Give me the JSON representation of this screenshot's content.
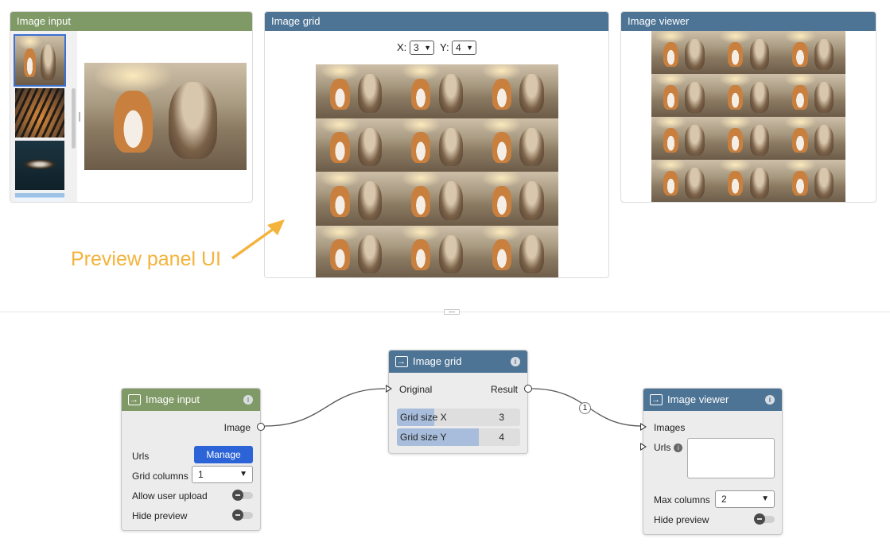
{
  "preview": {
    "image_input": {
      "title": "Image input"
    },
    "image_grid": {
      "title": "Image grid",
      "x_label": "X:",
      "x_value": "3",
      "y_label": "Y:",
      "y_value": "4"
    },
    "image_viewer": {
      "title": "Image viewer"
    }
  },
  "annotation": {
    "text": "Preview panel UI",
    "color": "#f4b33c"
  },
  "nodes": {
    "image_input": {
      "title": "Image input",
      "output_label": "Image",
      "urls_label": "Urls",
      "manage_label": "Manage",
      "grid_columns_label": "Grid columns",
      "grid_columns_value": "1",
      "allow_upload_label": "Allow user upload",
      "hide_preview_label": "Hide preview"
    },
    "image_grid": {
      "title": "Image grid",
      "input_label": "Original",
      "output_label": "Result",
      "grid_x_label": "Grid size X",
      "grid_x_value": "3",
      "grid_y_label": "Grid size Y",
      "grid_y_value": "4"
    },
    "image_viewer": {
      "title": "Image viewer",
      "images_label": "Images",
      "urls_label": "Urls",
      "max_columns_label": "Max columns",
      "max_columns_value": "2",
      "hide_preview_label": "Hide preview"
    }
  },
  "connection_badge": "1",
  "colors": {
    "green_header": "#7f9a66",
    "blue_header": "#4d7495",
    "accent_button": "#2c63d6"
  }
}
